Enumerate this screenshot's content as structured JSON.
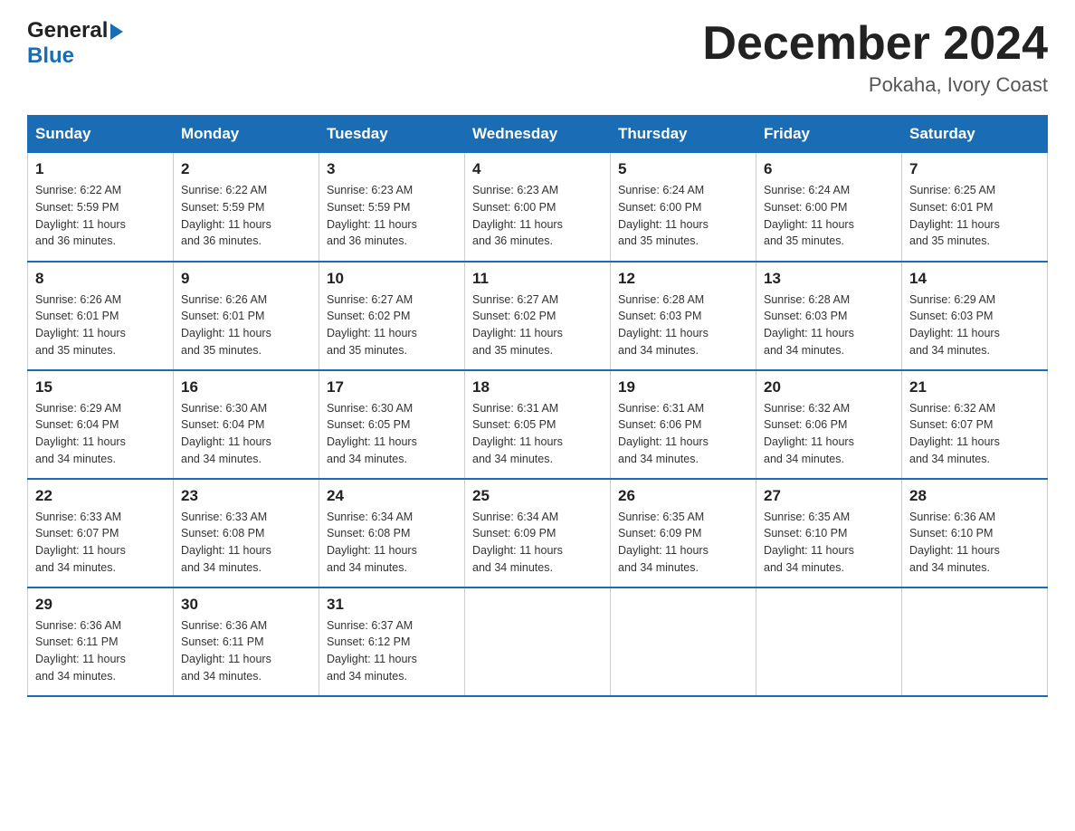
{
  "header": {
    "logo": {
      "general": "General",
      "blue": "Blue"
    },
    "title": "December 2024",
    "location": "Pokaha, Ivory Coast"
  },
  "weekdays": [
    "Sunday",
    "Monday",
    "Tuesday",
    "Wednesday",
    "Thursday",
    "Friday",
    "Saturday"
  ],
  "weeks": [
    [
      {
        "day": "1",
        "sunrise": "6:22 AM",
        "sunset": "5:59 PM",
        "daylight": "11 hours and 36 minutes."
      },
      {
        "day": "2",
        "sunrise": "6:22 AM",
        "sunset": "5:59 PM",
        "daylight": "11 hours and 36 minutes."
      },
      {
        "day": "3",
        "sunrise": "6:23 AM",
        "sunset": "5:59 PM",
        "daylight": "11 hours and 36 minutes."
      },
      {
        "day": "4",
        "sunrise": "6:23 AM",
        "sunset": "6:00 PM",
        "daylight": "11 hours and 36 minutes."
      },
      {
        "day": "5",
        "sunrise": "6:24 AM",
        "sunset": "6:00 PM",
        "daylight": "11 hours and 35 minutes."
      },
      {
        "day": "6",
        "sunrise": "6:24 AM",
        "sunset": "6:00 PM",
        "daylight": "11 hours and 35 minutes."
      },
      {
        "day": "7",
        "sunrise": "6:25 AM",
        "sunset": "6:01 PM",
        "daylight": "11 hours and 35 minutes."
      }
    ],
    [
      {
        "day": "8",
        "sunrise": "6:26 AM",
        "sunset": "6:01 PM",
        "daylight": "11 hours and 35 minutes."
      },
      {
        "day": "9",
        "sunrise": "6:26 AM",
        "sunset": "6:01 PM",
        "daylight": "11 hours and 35 minutes."
      },
      {
        "day": "10",
        "sunrise": "6:27 AM",
        "sunset": "6:02 PM",
        "daylight": "11 hours and 35 minutes."
      },
      {
        "day": "11",
        "sunrise": "6:27 AM",
        "sunset": "6:02 PM",
        "daylight": "11 hours and 35 minutes."
      },
      {
        "day": "12",
        "sunrise": "6:28 AM",
        "sunset": "6:03 PM",
        "daylight": "11 hours and 34 minutes."
      },
      {
        "day": "13",
        "sunrise": "6:28 AM",
        "sunset": "6:03 PM",
        "daylight": "11 hours and 34 minutes."
      },
      {
        "day": "14",
        "sunrise": "6:29 AM",
        "sunset": "6:03 PM",
        "daylight": "11 hours and 34 minutes."
      }
    ],
    [
      {
        "day": "15",
        "sunrise": "6:29 AM",
        "sunset": "6:04 PM",
        "daylight": "11 hours and 34 minutes."
      },
      {
        "day": "16",
        "sunrise": "6:30 AM",
        "sunset": "6:04 PM",
        "daylight": "11 hours and 34 minutes."
      },
      {
        "day": "17",
        "sunrise": "6:30 AM",
        "sunset": "6:05 PM",
        "daylight": "11 hours and 34 minutes."
      },
      {
        "day": "18",
        "sunrise": "6:31 AM",
        "sunset": "6:05 PM",
        "daylight": "11 hours and 34 minutes."
      },
      {
        "day": "19",
        "sunrise": "6:31 AM",
        "sunset": "6:06 PM",
        "daylight": "11 hours and 34 minutes."
      },
      {
        "day": "20",
        "sunrise": "6:32 AM",
        "sunset": "6:06 PM",
        "daylight": "11 hours and 34 minutes."
      },
      {
        "day": "21",
        "sunrise": "6:32 AM",
        "sunset": "6:07 PM",
        "daylight": "11 hours and 34 minutes."
      }
    ],
    [
      {
        "day": "22",
        "sunrise": "6:33 AM",
        "sunset": "6:07 PM",
        "daylight": "11 hours and 34 minutes."
      },
      {
        "day": "23",
        "sunrise": "6:33 AM",
        "sunset": "6:08 PM",
        "daylight": "11 hours and 34 minutes."
      },
      {
        "day": "24",
        "sunrise": "6:34 AM",
        "sunset": "6:08 PM",
        "daylight": "11 hours and 34 minutes."
      },
      {
        "day": "25",
        "sunrise": "6:34 AM",
        "sunset": "6:09 PM",
        "daylight": "11 hours and 34 minutes."
      },
      {
        "day": "26",
        "sunrise": "6:35 AM",
        "sunset": "6:09 PM",
        "daylight": "11 hours and 34 minutes."
      },
      {
        "day": "27",
        "sunrise": "6:35 AM",
        "sunset": "6:10 PM",
        "daylight": "11 hours and 34 minutes."
      },
      {
        "day": "28",
        "sunrise": "6:36 AM",
        "sunset": "6:10 PM",
        "daylight": "11 hours and 34 minutes."
      }
    ],
    [
      {
        "day": "29",
        "sunrise": "6:36 AM",
        "sunset": "6:11 PM",
        "daylight": "11 hours and 34 minutes."
      },
      {
        "day": "30",
        "sunrise": "6:36 AM",
        "sunset": "6:11 PM",
        "daylight": "11 hours and 34 minutes."
      },
      {
        "day": "31",
        "sunrise": "6:37 AM",
        "sunset": "6:12 PM",
        "daylight": "11 hours and 34 minutes."
      },
      null,
      null,
      null,
      null
    ]
  ],
  "labels": {
    "sunrise": "Sunrise:",
    "sunset": "Sunset:",
    "daylight": "Daylight:"
  }
}
